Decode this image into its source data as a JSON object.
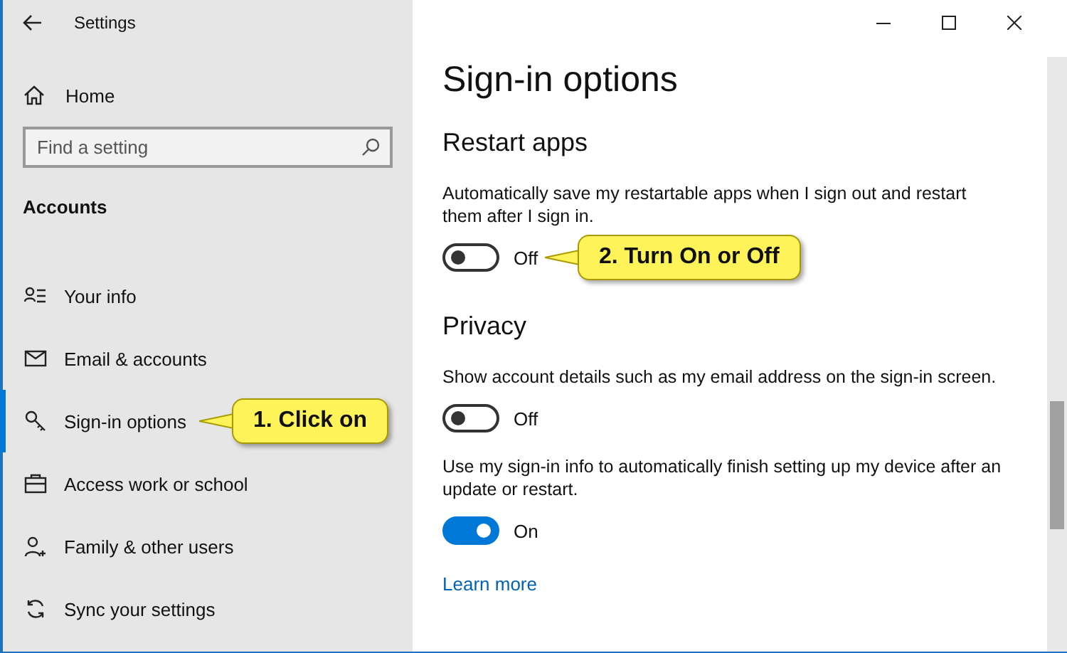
{
  "window": {
    "title": "Settings"
  },
  "sidebar": {
    "home": "Home",
    "search": {
      "placeholder": "Find a setting"
    },
    "section": "Accounts",
    "items": [
      {
        "kind": "info",
        "label": "Your info",
        "selected": false
      },
      {
        "kind": "email",
        "label": "Email & accounts",
        "selected": false
      },
      {
        "kind": "key",
        "label": "Sign-in options",
        "selected": true,
        "callout": "1. Click on"
      },
      {
        "kind": "work",
        "label": "Access work or school",
        "selected": false
      },
      {
        "kind": "family",
        "label": "Family & other users",
        "selected": false
      },
      {
        "kind": "sync",
        "label": "Sync your settings",
        "selected": false
      }
    ]
  },
  "main": {
    "title": "Sign-in options",
    "sections": [
      {
        "heading": "Restart apps",
        "settings": [
          {
            "description": "Automatically save my restartable apps when I sign out and restart them after I sign in.",
            "on": false,
            "state_label": "Off",
            "callout": "2. Turn On or Off"
          }
        ]
      },
      {
        "heading": "Privacy",
        "settings": [
          {
            "description": "Show account details such as my email address on the sign-in screen.",
            "on": false,
            "state_label": "Off"
          },
          {
            "description": "Use my sign-in info to automatically finish setting up my device after an update or restart.",
            "on": true,
            "state_label": "On"
          }
        ],
        "link": "Learn more"
      }
    ]
  }
}
